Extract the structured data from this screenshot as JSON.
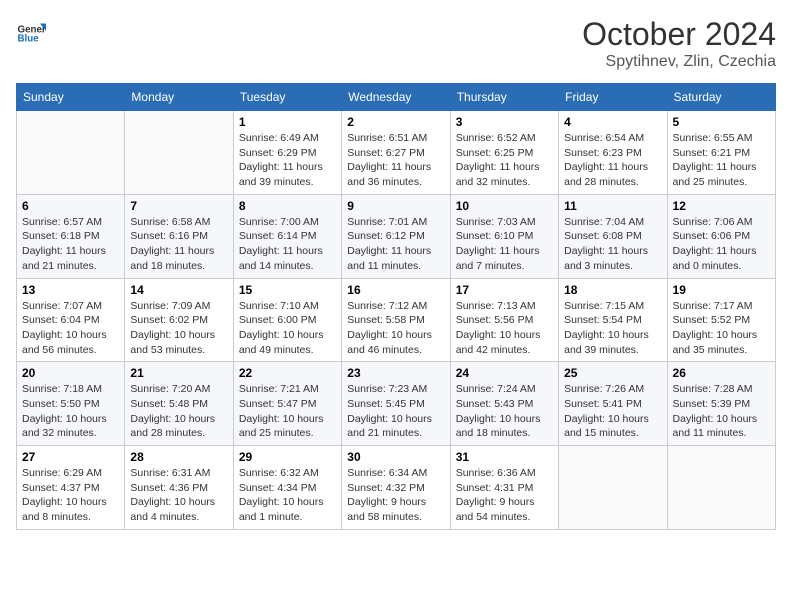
{
  "header": {
    "logo_general": "General",
    "logo_blue": "Blue",
    "month_title": "October 2024",
    "location": "Spytihnev, Zlin, Czechia"
  },
  "days_of_week": [
    "Sunday",
    "Monday",
    "Tuesday",
    "Wednesday",
    "Thursday",
    "Friday",
    "Saturday"
  ],
  "weeks": [
    [
      {
        "day": "",
        "content": ""
      },
      {
        "day": "",
        "content": ""
      },
      {
        "day": "1",
        "content": "Sunrise: 6:49 AM\nSunset: 6:29 PM\nDaylight: 11 hours and 39 minutes."
      },
      {
        "day": "2",
        "content": "Sunrise: 6:51 AM\nSunset: 6:27 PM\nDaylight: 11 hours and 36 minutes."
      },
      {
        "day": "3",
        "content": "Sunrise: 6:52 AM\nSunset: 6:25 PM\nDaylight: 11 hours and 32 minutes."
      },
      {
        "day": "4",
        "content": "Sunrise: 6:54 AM\nSunset: 6:23 PM\nDaylight: 11 hours and 28 minutes."
      },
      {
        "day": "5",
        "content": "Sunrise: 6:55 AM\nSunset: 6:21 PM\nDaylight: 11 hours and 25 minutes."
      }
    ],
    [
      {
        "day": "6",
        "content": "Sunrise: 6:57 AM\nSunset: 6:18 PM\nDaylight: 11 hours and 21 minutes."
      },
      {
        "day": "7",
        "content": "Sunrise: 6:58 AM\nSunset: 6:16 PM\nDaylight: 11 hours and 18 minutes."
      },
      {
        "day": "8",
        "content": "Sunrise: 7:00 AM\nSunset: 6:14 PM\nDaylight: 11 hours and 14 minutes."
      },
      {
        "day": "9",
        "content": "Sunrise: 7:01 AM\nSunset: 6:12 PM\nDaylight: 11 hours and 11 minutes."
      },
      {
        "day": "10",
        "content": "Sunrise: 7:03 AM\nSunset: 6:10 PM\nDaylight: 11 hours and 7 minutes."
      },
      {
        "day": "11",
        "content": "Sunrise: 7:04 AM\nSunset: 6:08 PM\nDaylight: 11 hours and 3 minutes."
      },
      {
        "day": "12",
        "content": "Sunrise: 7:06 AM\nSunset: 6:06 PM\nDaylight: 11 hours and 0 minutes."
      }
    ],
    [
      {
        "day": "13",
        "content": "Sunrise: 7:07 AM\nSunset: 6:04 PM\nDaylight: 10 hours and 56 minutes."
      },
      {
        "day": "14",
        "content": "Sunrise: 7:09 AM\nSunset: 6:02 PM\nDaylight: 10 hours and 53 minutes."
      },
      {
        "day": "15",
        "content": "Sunrise: 7:10 AM\nSunset: 6:00 PM\nDaylight: 10 hours and 49 minutes."
      },
      {
        "day": "16",
        "content": "Sunrise: 7:12 AM\nSunset: 5:58 PM\nDaylight: 10 hours and 46 minutes."
      },
      {
        "day": "17",
        "content": "Sunrise: 7:13 AM\nSunset: 5:56 PM\nDaylight: 10 hours and 42 minutes."
      },
      {
        "day": "18",
        "content": "Sunrise: 7:15 AM\nSunset: 5:54 PM\nDaylight: 10 hours and 39 minutes."
      },
      {
        "day": "19",
        "content": "Sunrise: 7:17 AM\nSunset: 5:52 PM\nDaylight: 10 hours and 35 minutes."
      }
    ],
    [
      {
        "day": "20",
        "content": "Sunrise: 7:18 AM\nSunset: 5:50 PM\nDaylight: 10 hours and 32 minutes."
      },
      {
        "day": "21",
        "content": "Sunrise: 7:20 AM\nSunset: 5:48 PM\nDaylight: 10 hours and 28 minutes."
      },
      {
        "day": "22",
        "content": "Sunrise: 7:21 AM\nSunset: 5:47 PM\nDaylight: 10 hours and 25 minutes."
      },
      {
        "day": "23",
        "content": "Sunrise: 7:23 AM\nSunset: 5:45 PM\nDaylight: 10 hours and 21 minutes."
      },
      {
        "day": "24",
        "content": "Sunrise: 7:24 AM\nSunset: 5:43 PM\nDaylight: 10 hours and 18 minutes."
      },
      {
        "day": "25",
        "content": "Sunrise: 7:26 AM\nSunset: 5:41 PM\nDaylight: 10 hours and 15 minutes."
      },
      {
        "day": "26",
        "content": "Sunrise: 7:28 AM\nSunset: 5:39 PM\nDaylight: 10 hours and 11 minutes."
      }
    ],
    [
      {
        "day": "27",
        "content": "Sunrise: 6:29 AM\nSunset: 4:37 PM\nDaylight: 10 hours and 8 minutes."
      },
      {
        "day": "28",
        "content": "Sunrise: 6:31 AM\nSunset: 4:36 PM\nDaylight: 10 hours and 4 minutes."
      },
      {
        "day": "29",
        "content": "Sunrise: 6:32 AM\nSunset: 4:34 PM\nDaylight: 10 hours and 1 minute."
      },
      {
        "day": "30",
        "content": "Sunrise: 6:34 AM\nSunset: 4:32 PM\nDaylight: 9 hours and 58 minutes."
      },
      {
        "day": "31",
        "content": "Sunrise: 6:36 AM\nSunset: 4:31 PM\nDaylight: 9 hours and 54 minutes."
      },
      {
        "day": "",
        "content": ""
      },
      {
        "day": "",
        "content": ""
      }
    ]
  ]
}
